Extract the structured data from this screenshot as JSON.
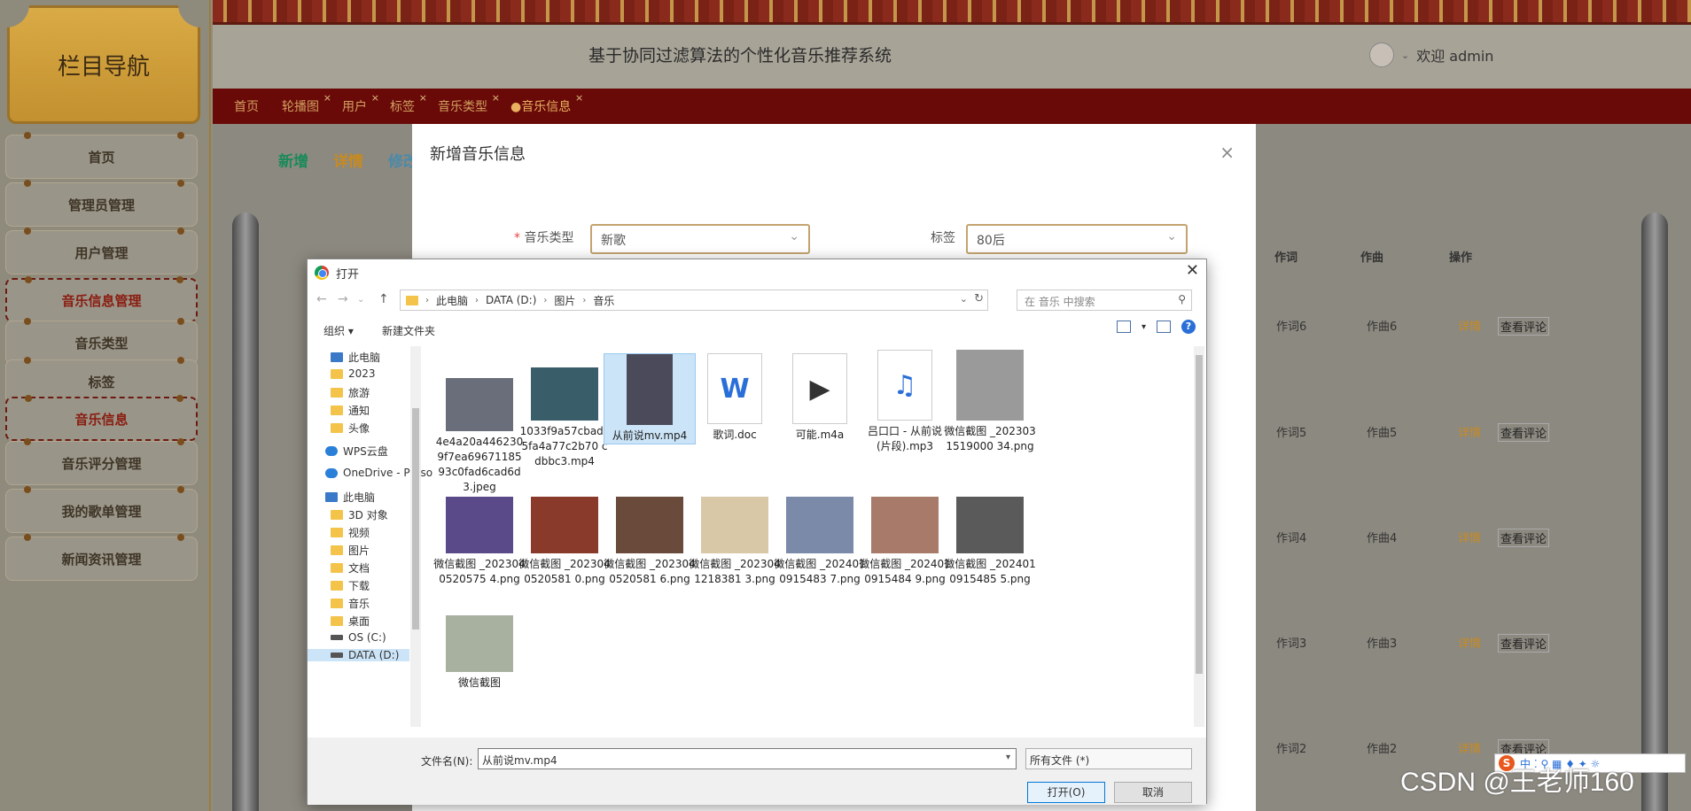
{
  "sidebar": {
    "title": "栏目导航",
    "items": [
      {
        "label": "首页",
        "active": false
      },
      {
        "label": "管理员管理",
        "active": false
      },
      {
        "label": "用户管理",
        "active": false
      },
      {
        "label": "音乐信息管理",
        "active": true
      },
      {
        "label": "音乐类型",
        "active": false
      },
      {
        "label": "标签",
        "active": false
      },
      {
        "label": "音乐信息",
        "active": true
      },
      {
        "label": "音乐评分管理",
        "active": false
      },
      {
        "label": "我的歌单管理",
        "active": false
      },
      {
        "label": "新闻资讯管理",
        "active": false
      }
    ]
  },
  "header": {
    "title": "基于协同过滤算法的个性化音乐推荐系统",
    "welcome": "欢迎 admin"
  },
  "tabs": [
    {
      "label": "首页",
      "closable": false
    },
    {
      "label": "轮播图",
      "closable": true
    },
    {
      "label": "用户",
      "closable": true
    },
    {
      "label": "标签",
      "closable": true
    },
    {
      "label": "音乐类型",
      "closable": true
    },
    {
      "label": "●音乐信息",
      "closable": true
    }
  ],
  "actions": {
    "add": "新增",
    "detail": "详情",
    "edit": "修改"
  },
  "table": {
    "headers": {
      "lyric": "作词",
      "composer": "作曲",
      "ops": "操作"
    },
    "rows": [
      {
        "lyric": "作词6",
        "composer": "作曲6",
        "detail": "详情",
        "comments": "查看评论"
      },
      {
        "lyric": "作词5",
        "composer": "作曲5",
        "detail": "详情",
        "comments": "查看评论"
      },
      {
        "lyric": "作词4",
        "composer": "作曲4",
        "detail": "详情",
        "comments": "查看评论"
      },
      {
        "lyric": "作词3",
        "composer": "作曲3",
        "detail": "详情",
        "comments": "查看评论"
      },
      {
        "lyric": "作词2",
        "composer": "作曲2",
        "detail": "详情",
        "comments": "查看评论"
      }
    ]
  },
  "modal": {
    "title": "新增音乐信息",
    "close": "×",
    "type_label": "音乐类型",
    "type_value": "新歌",
    "tag_label": "标签",
    "tag_value": "80后"
  },
  "dialog": {
    "title": "打开",
    "close": "✕",
    "breadcrumb": [
      "此电脑",
      "DATA (D:)",
      "图片",
      "音乐"
    ],
    "search_placeholder": "在 音乐 中搜索",
    "organize": "组织 ▾",
    "new_folder": "新建文件夹",
    "nav": [
      {
        "label": "此电脑",
        "icon": "pc"
      },
      {
        "label": "2023",
        "icon": "folder"
      },
      {
        "label": "旅游",
        "icon": "folder"
      },
      {
        "label": "通知",
        "icon": "folder"
      },
      {
        "label": "头像",
        "icon": "folder"
      },
      {
        "label": "WPS云盘",
        "icon": "cloud"
      },
      {
        "label": "OneDrive - Perso",
        "icon": "cloud"
      },
      {
        "label": "此电脑",
        "icon": "pc"
      },
      {
        "label": "3D 对象",
        "icon": "folder"
      },
      {
        "label": "视频",
        "icon": "folder"
      },
      {
        "label": "图片",
        "icon": "folder"
      },
      {
        "label": "文档",
        "icon": "folder"
      },
      {
        "label": "下载",
        "icon": "folder"
      },
      {
        "label": "音乐",
        "icon": "folder"
      },
      {
        "label": "桌面",
        "icon": "folder"
      },
      {
        "label": "OS (C:)",
        "icon": "drive"
      },
      {
        "label": "DATA (D:)",
        "icon": "drive"
      }
    ],
    "files": [
      {
        "name": "4e4a20a4462309f7ea69671185 93c0fad6cad6d3.jpeg",
        "kind": "image",
        "color": "#6a6e7a"
      },
      {
        "name": "1033f9a57cbadc5fa4a77c2b70 cdbbc3.mp4",
        "kind": "video",
        "color": "#3a5d6a"
      },
      {
        "name": "从前说mv.mp4",
        "kind": "video",
        "color": "#4a4a5a",
        "selected": true
      },
      {
        "name": "歌词.doc",
        "kind": "doc",
        "color": "#2a6fd8"
      },
      {
        "name": "可能.m4a",
        "kind": "audio",
        "color": "#333333"
      },
      {
        "name": "吕口口 - 从前说 (片段).mp3",
        "kind": "mp3",
        "color": "#2a6fd8"
      },
      {
        "name": "微信截图 _2023031519000 34.png",
        "kind": "image",
        "color": "#9a9a9a"
      },
      {
        "name": "微信截图 _2023040520575 4.png",
        "kind": "image",
        "color": "#5a4a8a"
      },
      {
        "name": "微信截图 _2023040520581 0.png",
        "kind": "image",
        "color": "#8a3a2a"
      },
      {
        "name": "微信截图 _2023040520581 6.png",
        "kind": "image",
        "color": "#6a4a3a"
      },
      {
        "name": "微信截图 _2023041218381 3.png",
        "kind": "image",
        "color": "#d8c8a8"
      },
      {
        "name": "微信截图 _2024010915483 7.png",
        "kind": "image",
        "color": "#7a8aa8"
      },
      {
        "name": "微信截图 _2024010915484 9.png",
        "kind": "image",
        "color": "#a87a6a"
      },
      {
        "name": "微信截图 _2024010915485 5.png",
        "kind": "image",
        "color": "#5a5a5a"
      },
      {
        "name": "微信截图",
        "kind": "image",
        "color": "#a8b0a0"
      }
    ],
    "filename_label": "文件名(N):",
    "filename_value": "从前说mv.mp4",
    "filetype_value": "所有文件 (*)",
    "open": "打开(O)",
    "cancel": "取消"
  },
  "watermark": "CSDN @王老师160",
  "ime": {
    "logo": "S",
    "text": "中 ⁚ ⚲ ▦ ♦ ✦ ☼"
  }
}
